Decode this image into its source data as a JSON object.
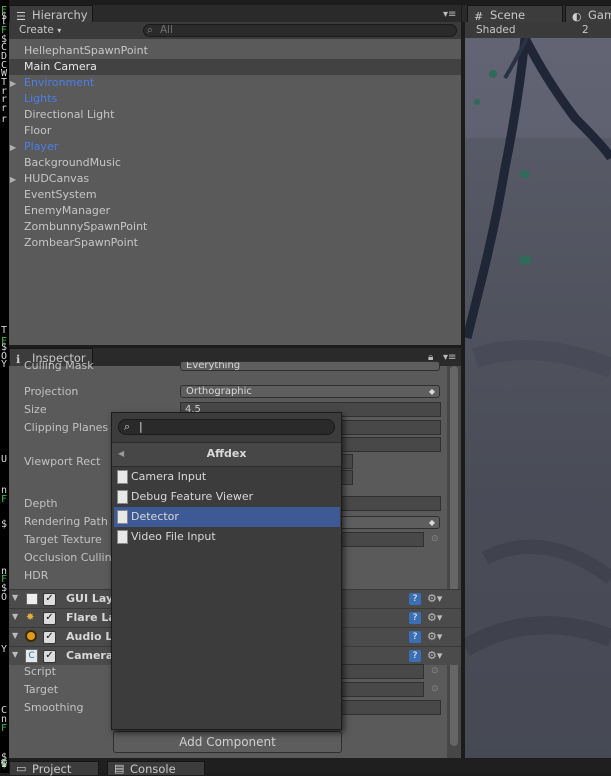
{
  "terminal": {
    "chars": [
      {
        "t": "F",
        "g": true
      },
      {
        "t": "$",
        "g": false
      },
      {
        "t": "[",
        "g": false
      },
      {
        "t": "F",
        "g": true
      },
      {
        "t": "$",
        "g": false
      },
      {
        "t": "C",
        "g": false
      },
      {
        "t": "D",
        "g": false
      },
      {
        "t": "C",
        "g": false
      },
      {
        "t": "W",
        "g": false
      },
      {
        "t": "T",
        "g": false
      },
      {
        "t": "r",
        "g": false
      },
      {
        "t": "r",
        "g": false
      },
      {
        "t": "r",
        "g": false
      },
      {
        "t": "r",
        "g": false
      },
      {
        "t": "T",
        "g": false
      },
      {
        "t": "F",
        "g": true
      },
      {
        "t": "$",
        "g": false
      },
      {
        "t": "O",
        "g": false
      },
      {
        "t": "Y",
        "g": false
      },
      {
        "t": "U",
        "g": false
      },
      {
        "t": "n",
        "g": false
      },
      {
        "t": "F",
        "g": true
      },
      {
        "t": "$",
        "g": false
      },
      {
        "t": "n",
        "g": false
      },
      {
        "t": "F",
        "g": true
      },
      {
        "t": "$",
        "g": false
      },
      {
        "t": "O",
        "g": false
      },
      {
        "t": "Y",
        "g": false
      },
      {
        "t": "C",
        "g": false
      },
      {
        "t": "n",
        "g": false
      },
      {
        "t": "F",
        "g": true
      },
      {
        "t": "$",
        "g": false
      },
      {
        "t": "w",
        "g": false
      },
      {
        "t": "T",
        "g": false
      },
      {
        "t": "F",
        "g": true
      },
      {
        "t": "$",
        "g": false
      }
    ]
  },
  "hierarchy": {
    "tab_label": "Hierarchy",
    "create_label": "Create",
    "search_placeholder": "All",
    "items": [
      {
        "label": "HellephantSpawnPoint",
        "blue": false,
        "fold": false
      },
      {
        "label": "Main Camera",
        "blue": false,
        "fold": false,
        "selected": true
      },
      {
        "label": "Environment",
        "blue": true,
        "fold": true
      },
      {
        "label": "Lights",
        "blue": true,
        "fold": false
      },
      {
        "label": "Directional Light",
        "blue": false,
        "fold": false
      },
      {
        "label": "Floor",
        "blue": false,
        "fold": false
      },
      {
        "label": "Player",
        "blue": true,
        "fold": true
      },
      {
        "label": "BackgroundMusic",
        "blue": false,
        "fold": false
      },
      {
        "label": "HUDCanvas",
        "blue": false,
        "fold": true
      },
      {
        "label": "EventSystem",
        "blue": false,
        "fold": false
      },
      {
        "label": "EnemyManager",
        "blue": false,
        "fold": false
      },
      {
        "label": "ZombunnySpawnPoint",
        "blue": false,
        "fold": false
      },
      {
        "label": "ZombearSpawnPoint",
        "blue": false,
        "fold": false
      }
    ]
  },
  "scene": {
    "tab_label": "Scene",
    "tab2_label": "Gam",
    "shading": "Shaded",
    "mode": "2"
  },
  "inspector": {
    "tab_label": "Inspector",
    "culling_mask_label": "Culling Mask",
    "culling_mask_value": "Everything",
    "projection_label": "Projection",
    "projection_value": "Orthographic",
    "size_label": "Size",
    "size_value": "4.5",
    "clipping_label": "Clipping Planes",
    "viewport_label": "Viewport Rect",
    "depth_label": "Depth",
    "rendering_path_label": "Rendering Path",
    "target_texture_label": "Target Texture",
    "occlusion_label": "Occlusion Culling",
    "hdr_label": "HDR",
    "components": [
      {
        "name": "GUI Layer"
      },
      {
        "name": "Flare Layer"
      },
      {
        "name": "Audio Listener"
      },
      {
        "name": "Camera Follow"
      }
    ],
    "script_label": "Script",
    "target_label": "Target",
    "smoothing_label": "Smoothing",
    "add_component_label": "Add Component"
  },
  "popup": {
    "search_value": "|",
    "title": "Affdex",
    "items": [
      {
        "label": "Camera Input",
        "selected": false
      },
      {
        "label": "Debug Feature Viewer",
        "selected": false
      },
      {
        "label": "Detector",
        "selected": true
      },
      {
        "label": "Video File Input",
        "selected": false
      }
    ]
  },
  "bottom": {
    "project_label": "Project",
    "console_label": "Console"
  },
  "colors": {
    "selection": "#3d5a97",
    "prefab_blue": "#4b7ee8",
    "panel_bg": "#5a5a5a"
  }
}
